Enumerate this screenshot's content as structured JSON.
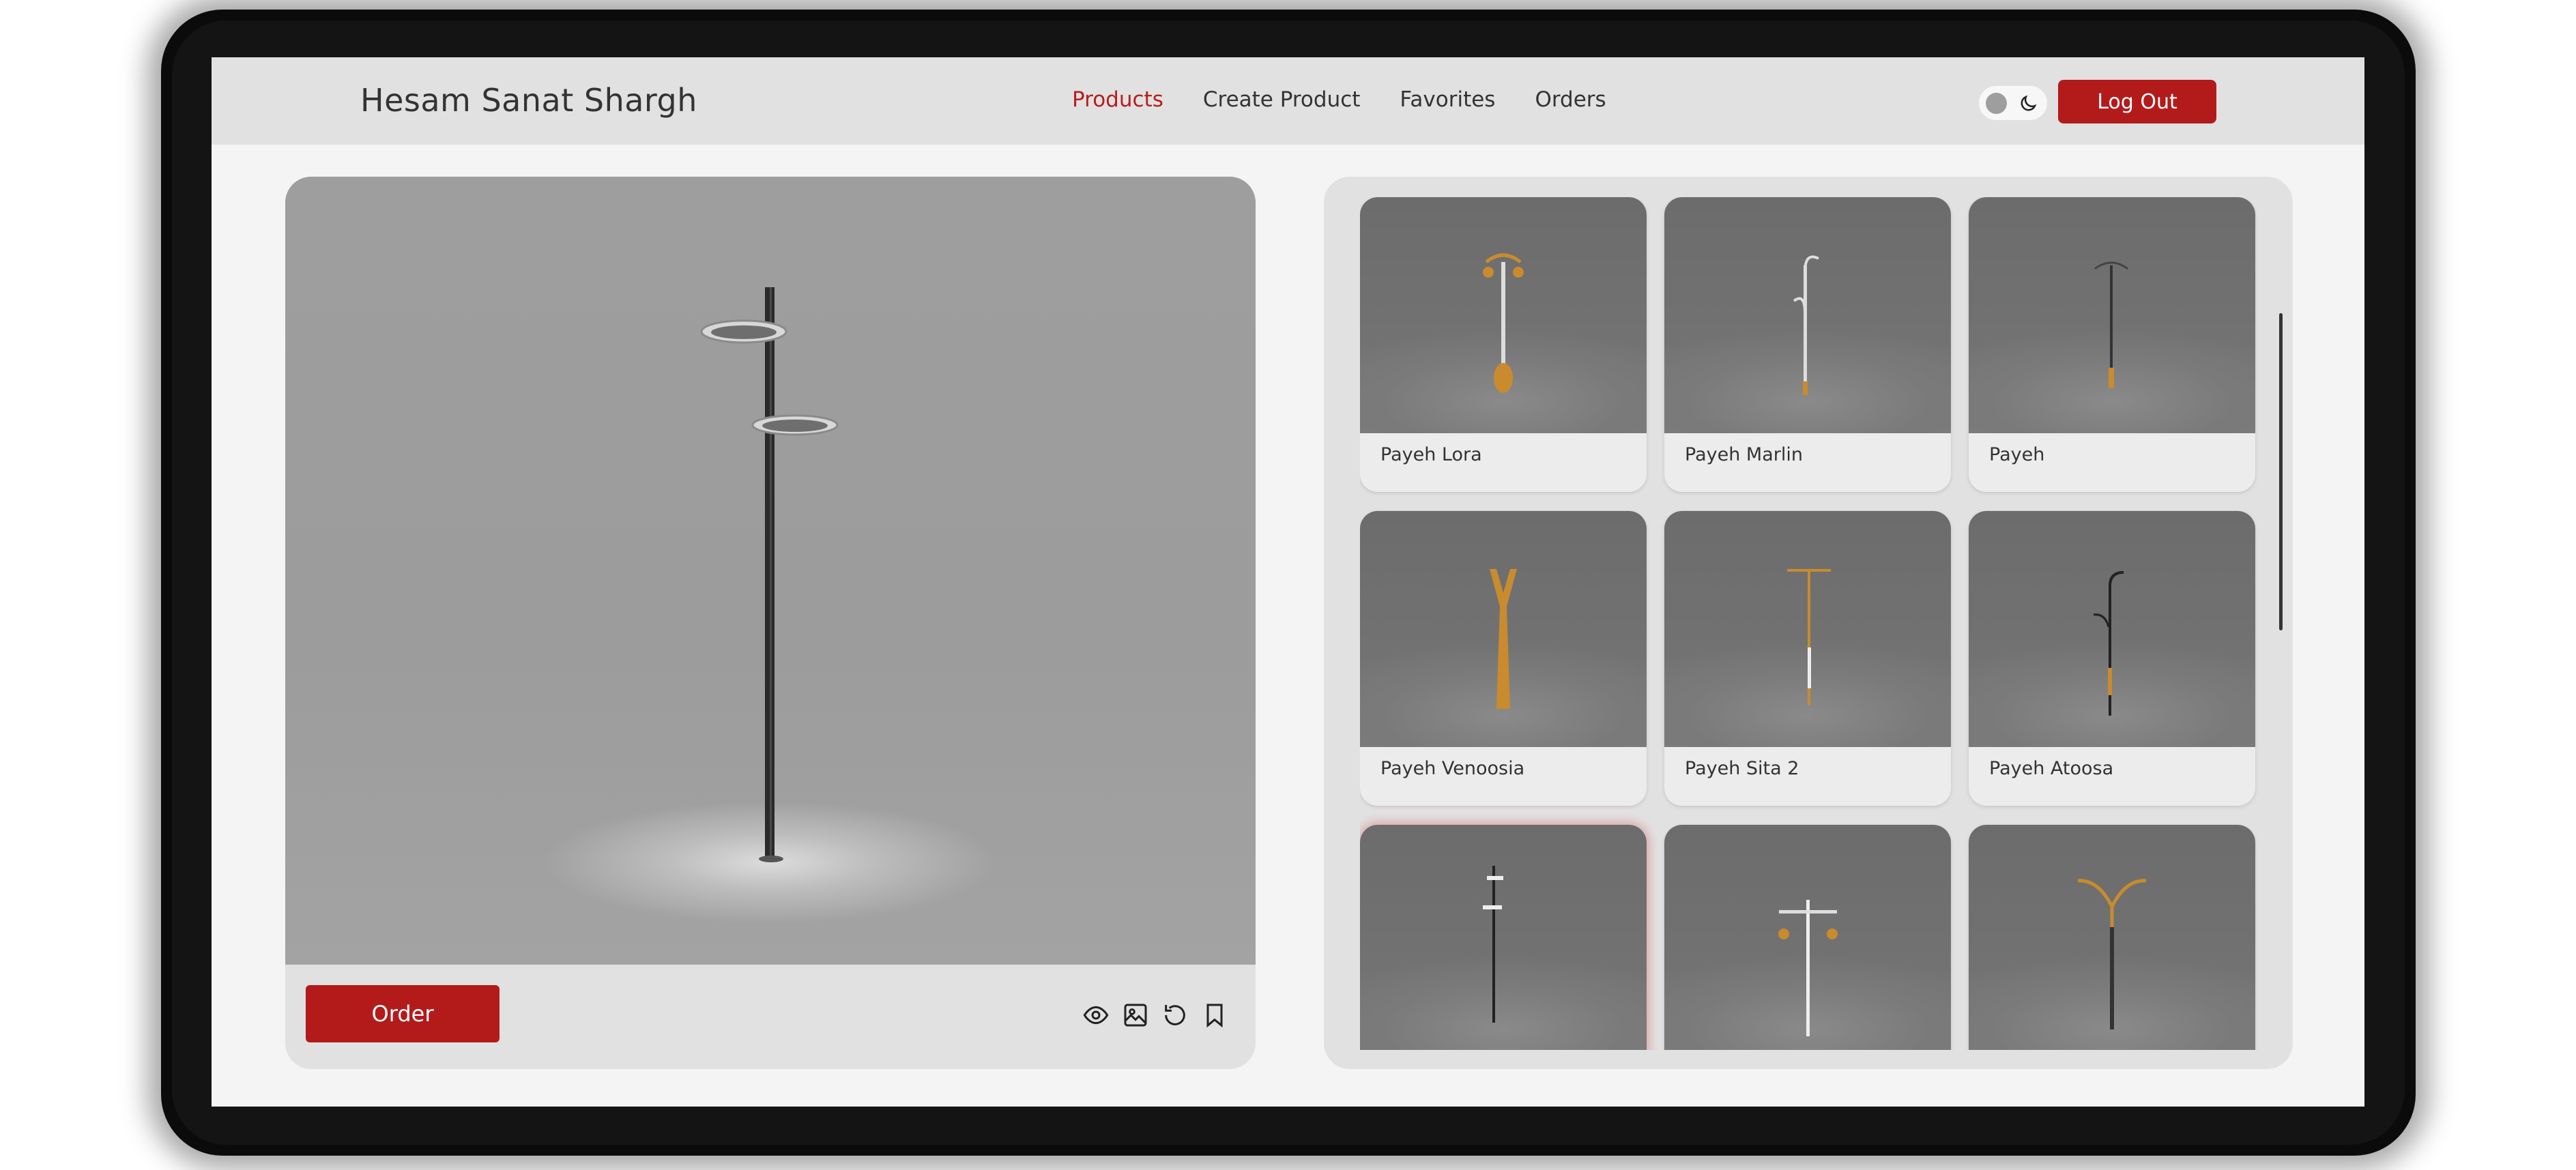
{
  "header": {
    "brand": "Hesam Sanat Shargh",
    "nav": [
      "Products",
      "Create Product",
      "Favorites",
      "Orders"
    ],
    "active_nav": "Products",
    "logout_label": "Log Out",
    "theme_toggle_icon": "moon-icon"
  },
  "viewer": {
    "order_label": "Order",
    "tools": [
      "eye-icon",
      "image-icon",
      "rotate-icon",
      "bookmark-icon"
    ]
  },
  "catalog": {
    "items": [
      {
        "label": "Payeh Lora"
      },
      {
        "label": "Payeh Marlin"
      },
      {
        "label": "Payeh"
      },
      {
        "label": "Payeh Venoosia"
      },
      {
        "label": "Payeh Sita 2"
      },
      {
        "label": "Payeh Atoosa"
      },
      {
        "label": ""
      },
      {
        "label": ""
      },
      {
        "label": ""
      }
    ]
  },
  "colors": {
    "accent": "#b31b1b",
    "header_bg": "#e2e1e1",
    "page_bg": "#f4f4f4"
  }
}
